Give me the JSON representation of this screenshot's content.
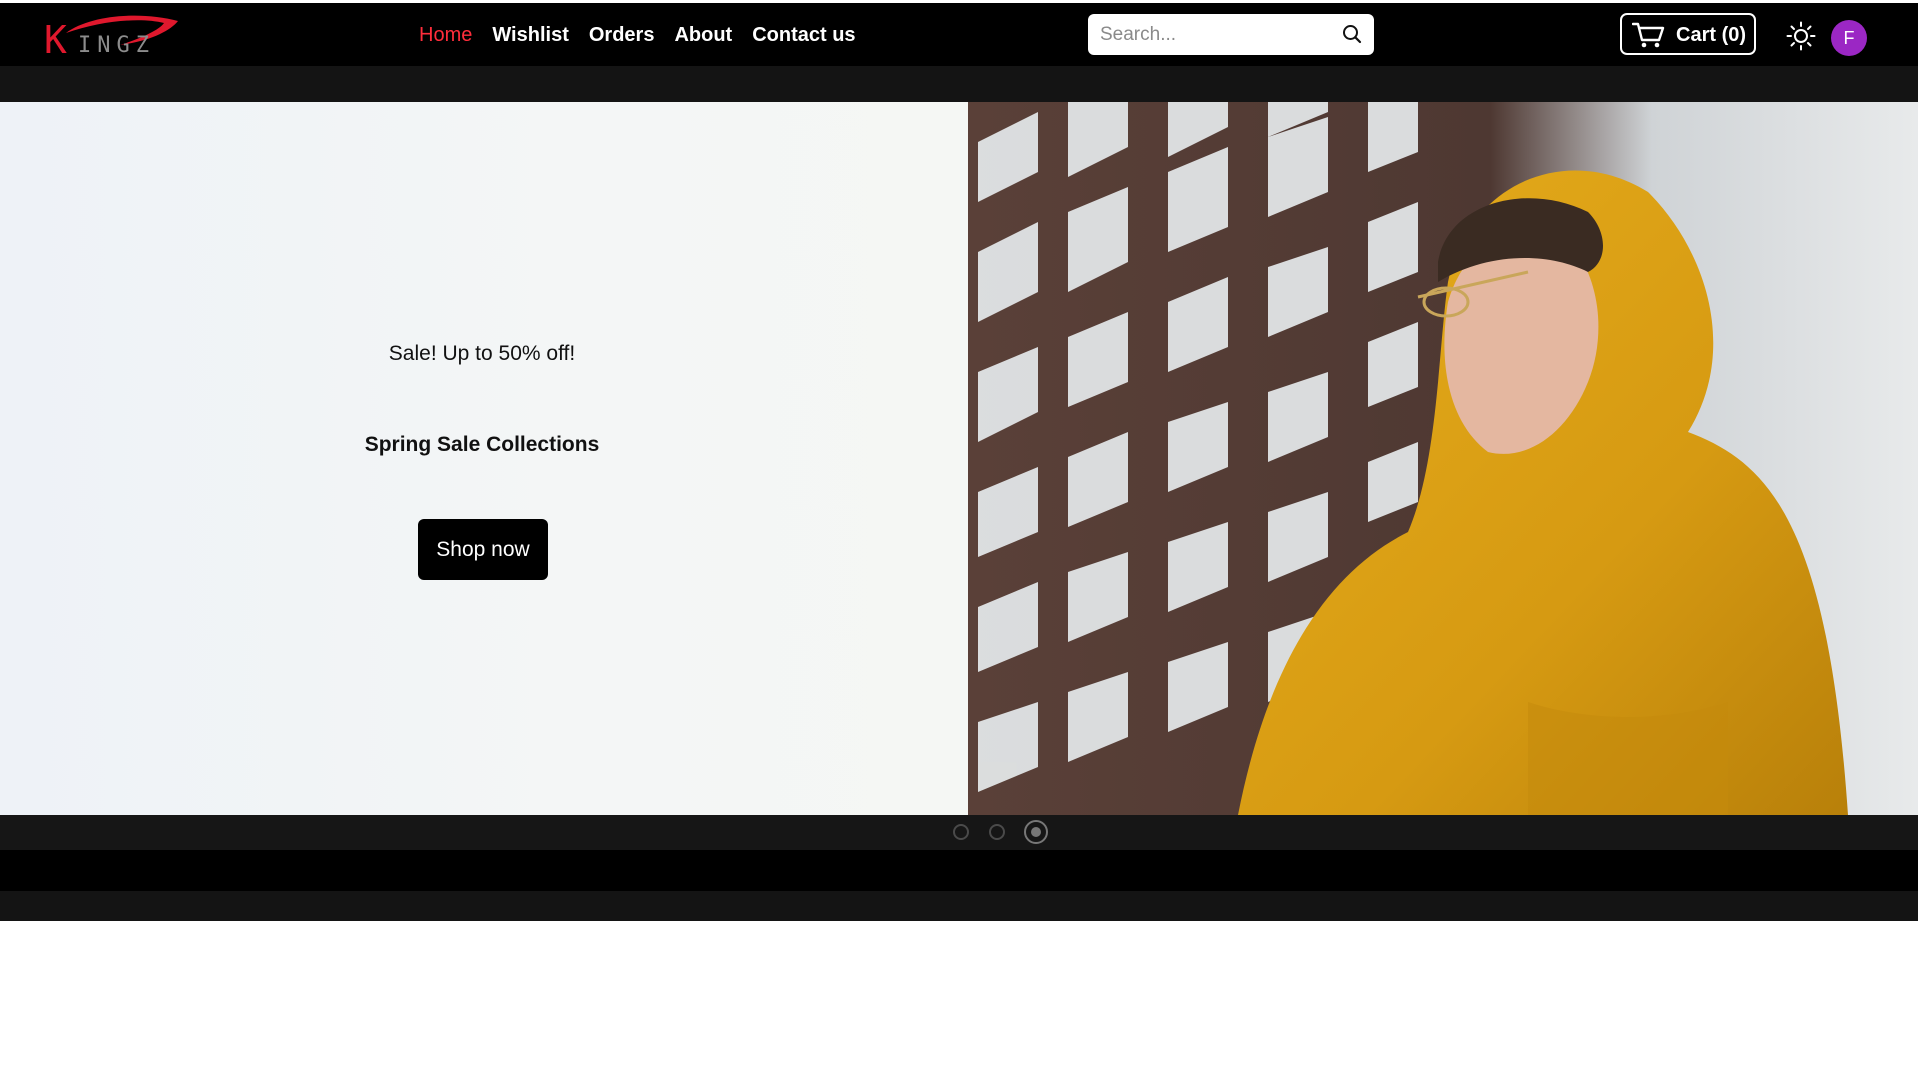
{
  "brand": {
    "logo_first": "K",
    "logo_rest": "INGZ",
    "accent": "#e0182d"
  },
  "nav": {
    "items": [
      {
        "label": "Home",
        "active": true
      },
      {
        "label": "Wishlist",
        "active": false
      },
      {
        "label": "Orders",
        "active": false
      },
      {
        "label": "About",
        "active": false
      },
      {
        "label": "Contact us",
        "active": false
      }
    ]
  },
  "search": {
    "placeholder": "Search...",
    "value": "",
    "icon": "search-icon"
  },
  "cart": {
    "label": "Cart (0)",
    "icon": "cart-icon"
  },
  "theme_toggle": {
    "icon": "sun-icon"
  },
  "user": {
    "initial": "F",
    "color": "#9b27c4"
  },
  "hero": {
    "promo_text": "Sale! Up to 50% off!",
    "title": "Spring Sale Collections",
    "cta_label": "Shop now"
  },
  "carousel": {
    "slide_count": 3,
    "active_index": 2
  }
}
